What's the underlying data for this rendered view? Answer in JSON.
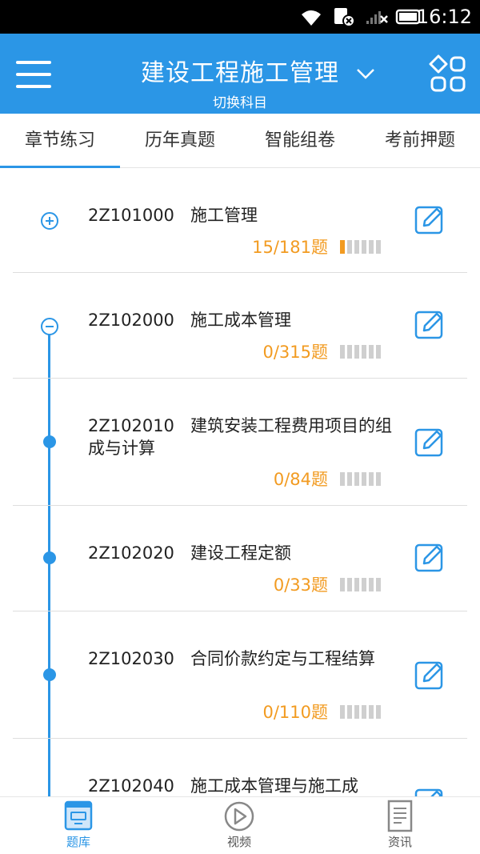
{
  "status_bar": {
    "time": "16:12"
  },
  "header": {
    "title": "建设工程施工管理",
    "subtitle": "切换科目"
  },
  "tabs": [
    {
      "label": "章节练习",
      "active": true
    },
    {
      "label": "历年真题",
      "active": false
    },
    {
      "label": "智能组卷",
      "active": false
    },
    {
      "label": "考前押题",
      "active": false
    }
  ],
  "chapters": [
    {
      "code": "2Z101000",
      "title": "施工管理",
      "progress": "15/181题",
      "level": "chapter",
      "expanded": false,
      "done_fraction": 0.08
    },
    {
      "code": "2Z102000",
      "title": "施工成本管理",
      "progress": "0/315题",
      "level": "chapter",
      "expanded": true,
      "done_fraction": 0
    },
    {
      "code": "2Z102010",
      "title": "建筑安装工程费用项目的组成与计算",
      "progress": "0/84题",
      "level": "section",
      "done_fraction": 0
    },
    {
      "code": "2Z102020",
      "title": "建设工程定额",
      "progress": "0/33题",
      "level": "section",
      "done_fraction": 0
    },
    {
      "code": "2Z102030",
      "title": "合同价款约定与工程结算",
      "progress": "0/110题",
      "level": "section",
      "done_fraction": 0
    },
    {
      "code": "2Z102040",
      "title": "施工成本管理与施工成",
      "progress": "",
      "level": "section",
      "done_fraction": 0
    }
  ],
  "bottom_nav": [
    {
      "label": "题库",
      "icon": "question-bank-icon",
      "active": true
    },
    {
      "label": "视频",
      "icon": "play-icon",
      "active": false
    },
    {
      "label": "资讯",
      "icon": "news-document-icon",
      "active": false
    }
  ],
  "colors": {
    "accent": "#2b96e6",
    "progress": "#f29b21",
    "bar_empty": "#cfcfcf"
  }
}
